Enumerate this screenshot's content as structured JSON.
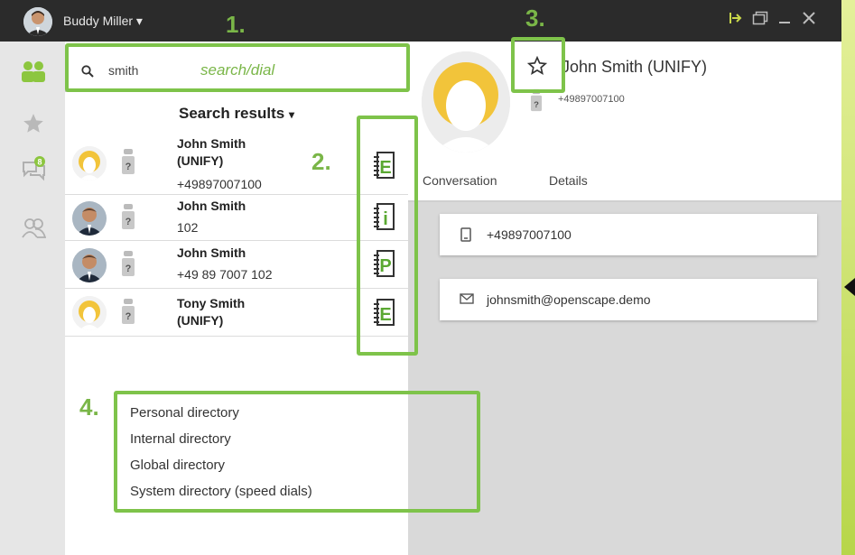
{
  "titlebar": {
    "user_name": "Buddy Miller",
    "dropdown_glyph": "▾",
    "controls": [
      "pin-icon",
      "restore-icon",
      "minimize-icon",
      "close-icon"
    ]
  },
  "nav": {
    "badge_count": "8",
    "items": [
      "contacts-icon",
      "favorites-icon",
      "conversations-icon",
      "groups-icon"
    ]
  },
  "search": {
    "value": "smith",
    "hint": "search/dial"
  },
  "results": {
    "header": "Search results",
    "items": [
      {
        "name_line1": "John Smith",
        "name_line2": "(UNIFY)",
        "detail": "+49897007100",
        "directory": "E",
        "avatar": "placeholder"
      },
      {
        "name_line1": "John Smith",
        "name_line2": "",
        "detail": "102",
        "directory": "i",
        "avatar": "photo"
      },
      {
        "name_line1": "John Smith",
        "name_line2": "",
        "detail": "+49 89 7007 102",
        "directory": "P",
        "avatar": "photo"
      },
      {
        "name_line1": "Tony Smith",
        "name_line2": "(UNIFY)",
        "detail": "",
        "directory": "E",
        "avatar": "placeholder"
      }
    ]
  },
  "directories": [
    {
      "label": "Personal directory",
      "on": true
    },
    {
      "label": "Internal directory",
      "on": true
    },
    {
      "label": "Global directory",
      "on": true
    },
    {
      "label": "System directory (speed dials)",
      "on": false
    }
  ],
  "detail": {
    "name": "John Smith (UNIFY)",
    "number": "+49897007100",
    "tabs": [
      "Conversation",
      "Details"
    ],
    "phone": "+49897007100",
    "email": "johnsmith@openscape.demo"
  },
  "annotations": [
    "1.",
    "2.",
    "3.",
    "4."
  ],
  "colors": {
    "accent": "#7ab648",
    "titlebar": "#2b2b2b",
    "avatar_yellow": "#f2c43a"
  }
}
